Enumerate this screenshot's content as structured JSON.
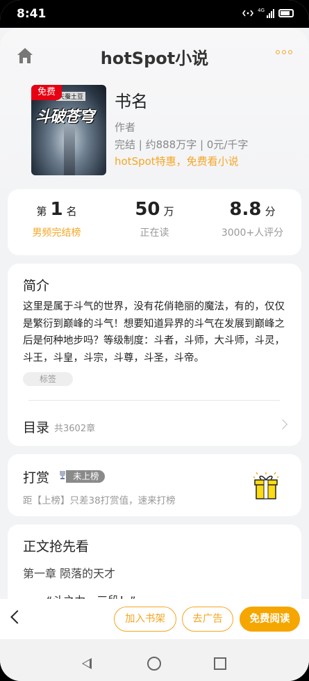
{
  "status": {
    "time": "8:41",
    "network": "4G"
  },
  "header": {
    "title": "hotSpot小说"
  },
  "book": {
    "badge": "免费",
    "name": "书名",
    "author": "作者",
    "meta": "完结 | 约888万字 | 0元/千字",
    "promo": "hotSpot特惠，免费看小说",
    "cover_title": "斗破苍穹",
    "cover_author": "天蚕土豆"
  },
  "stats": [
    {
      "prefix": "第",
      "value": "1",
      "suffix": "名",
      "label": "男频完结榜",
      "label_color": "orange"
    },
    {
      "prefix": "",
      "value": "50",
      "suffix": "万",
      "label": "正在读",
      "label_color": "gray"
    },
    {
      "prefix": "",
      "value": "8.8",
      "suffix": "分",
      "label": "3000+人评分",
      "label_color": "gray"
    }
  ],
  "intro": {
    "title": "简介",
    "text": "这里是属于斗气的世界，没有花俏艳丽的魔法，有的，仅仅是繁衍到巅峰的斗气！想要知道异界的斗气在发展到巅峰之后是何种地步吗？等级制度：斗者，斗师，大斗师，斗灵，斗王，斗皇，斗宗，斗尊，斗圣，斗帝。",
    "tag": "标签"
  },
  "toc": {
    "label": "目录",
    "count": "共3602章"
  },
  "reward": {
    "title": "打赏",
    "rank_badge": "未上榜",
    "text": "距【上榜】只差38打赏值，速来打榜"
  },
  "preview": {
    "title": "正文抢先看",
    "chapter": "第一章 陨落的天才",
    "first_line": "“斗之力，三段！”"
  },
  "bottom": {
    "shelf": "加入书架",
    "noad": "去广告",
    "read": "免费阅读"
  },
  "colors": {
    "accent": "#f5a623",
    "badge_red": "#e60012"
  }
}
